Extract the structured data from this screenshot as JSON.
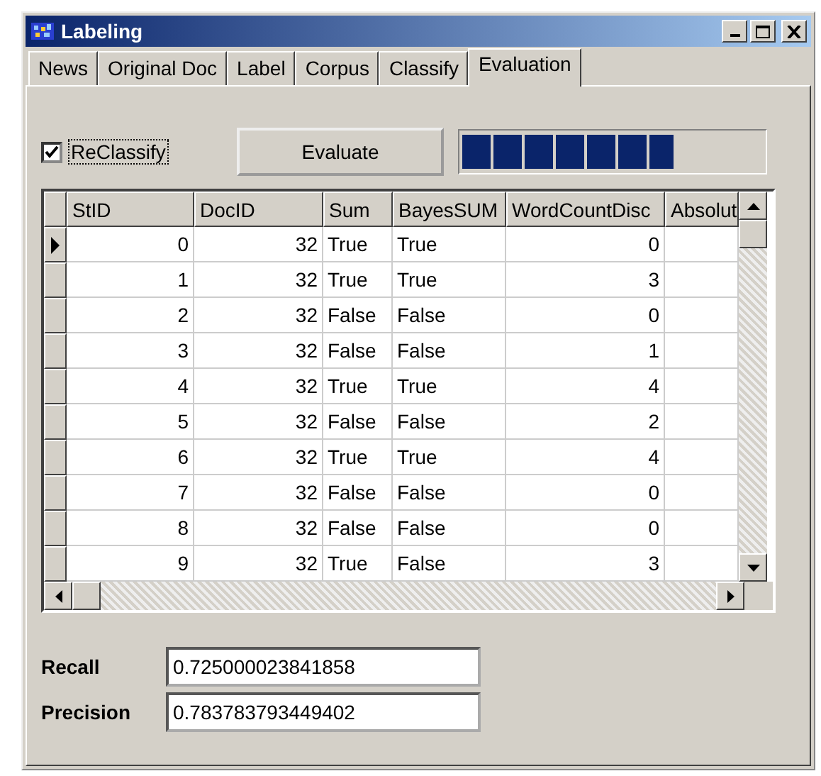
{
  "window": {
    "title": "Labeling"
  },
  "tabs": [
    {
      "label": "News",
      "selected": false
    },
    {
      "label": "Original Doc",
      "selected": false
    },
    {
      "label": "Label",
      "selected": false
    },
    {
      "label": "Corpus",
      "selected": false
    },
    {
      "label": "Classify",
      "selected": false
    },
    {
      "label": "Evaluation",
      "selected": true
    }
  ],
  "reclassify": {
    "label": "ReClassify",
    "checked": true
  },
  "evaluate_button": "Evaluate",
  "progress": {
    "level": 0.7
  },
  "table": {
    "columns": [
      "StID",
      "DocID",
      "Sum",
      "BayesSUM",
      "WordCountDisc",
      "Absolut"
    ],
    "rows": [
      {
        "selected": true,
        "cells": [
          "0",
          "32",
          "True",
          "True",
          "0",
          ""
        ]
      },
      {
        "selected": false,
        "cells": [
          "1",
          "32",
          "True",
          "True",
          "3",
          ""
        ]
      },
      {
        "selected": false,
        "cells": [
          "2",
          "32",
          "False",
          "False",
          "0",
          ""
        ]
      },
      {
        "selected": false,
        "cells": [
          "3",
          "32",
          "False",
          "False",
          "1",
          ""
        ]
      },
      {
        "selected": false,
        "cells": [
          "4",
          "32",
          "True",
          "True",
          "4",
          ""
        ]
      },
      {
        "selected": false,
        "cells": [
          "5",
          "32",
          "False",
          "False",
          "2",
          ""
        ]
      },
      {
        "selected": false,
        "cells": [
          "6",
          "32",
          "True",
          "True",
          "4",
          ""
        ]
      },
      {
        "selected": false,
        "cells": [
          "7",
          "32",
          "False",
          "False",
          "0",
          ""
        ]
      },
      {
        "selected": false,
        "cells": [
          "8",
          "32",
          "False",
          "False",
          "0",
          ""
        ]
      },
      {
        "selected": false,
        "cells": [
          "9",
          "32",
          "True",
          "False",
          "3",
          ""
        ]
      }
    ]
  },
  "fields": [
    {
      "label": "Recall",
      "value": "0.725000023841858"
    },
    {
      "label": "Precision",
      "value": "0.783783793449402"
    }
  ]
}
